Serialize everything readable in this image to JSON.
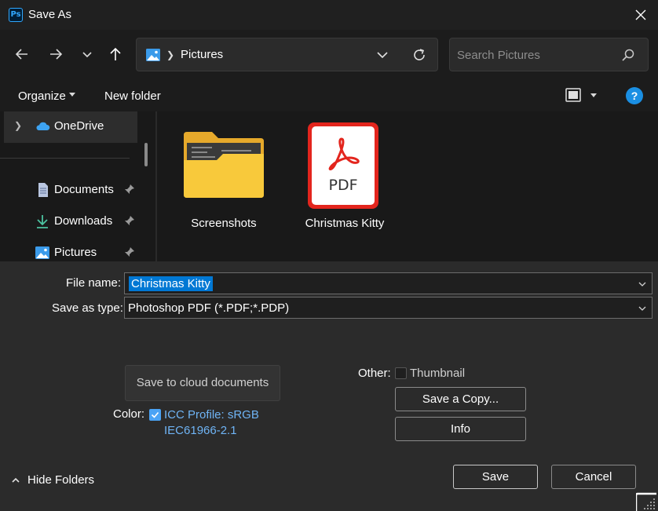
{
  "window": {
    "title": "Save As",
    "app_icon_text": "Ps"
  },
  "navigation": {
    "address_current": "Pictures",
    "search_placeholder": "Search Pictures"
  },
  "toolbar": {
    "organize_label": "Organize",
    "new_folder_label": "New folder"
  },
  "sidebar": {
    "items": [
      {
        "label": "OneDrive",
        "icon": "onedrive-cloud-icon",
        "expandable": true,
        "selected": true
      },
      {
        "label": "Documents",
        "icon": "document-icon",
        "pinned": true
      },
      {
        "label": "Downloads",
        "icon": "download-arrow-icon",
        "pinned": true
      },
      {
        "label": "Pictures",
        "icon": "picture-icon",
        "pinned": true
      }
    ]
  },
  "files": [
    {
      "name": "Screenshots",
      "type": "folder"
    },
    {
      "name": "Christmas Kitty",
      "type": "pdf",
      "icon_text": "PDF"
    }
  ],
  "form": {
    "file_name_label": "File name:",
    "file_name_value": "Christmas Kitty",
    "save_type_label": "Save as type:",
    "save_type_value": "Photoshop PDF (*.PDF;*.PDP)"
  },
  "options": {
    "cloud_button_label": "Save to cloud documents",
    "color_label": "Color:",
    "icc_line1": "ICC Profile:  sRGB",
    "icc_line2": "IEC61966-2.1",
    "icc_checked": true,
    "other_label": "Other:",
    "thumbnail_label": "Thumbnail",
    "thumbnail_checked": false,
    "save_copy_label": "Save a Copy...",
    "info_label": "Info"
  },
  "footer": {
    "hide_folders_label": "Hide Folders",
    "save_label": "Save",
    "cancel_label": "Cancel"
  },
  "colors": {
    "accent": "#0078d4",
    "link": "#6fb4f5",
    "pdf_red": "#e3251d",
    "folder_yellow": "#f8c93b"
  }
}
